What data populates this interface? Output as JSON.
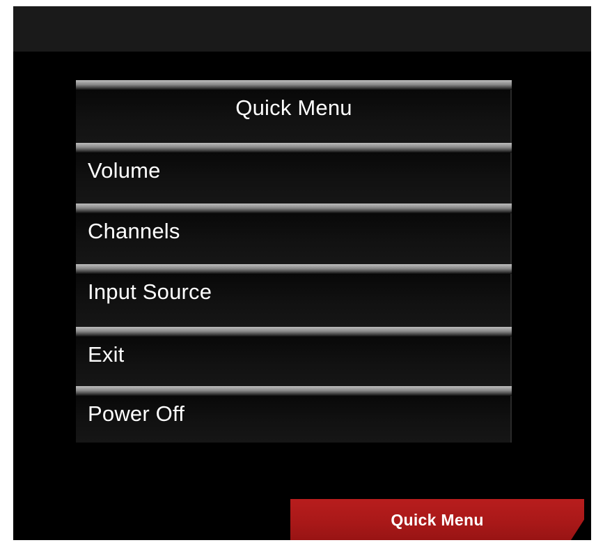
{
  "quick_menu": {
    "title": "Quick Menu",
    "items": [
      {
        "label": "Volume"
      },
      {
        "label": "Channels"
      },
      {
        "label": "Input Source"
      },
      {
        "label": "Exit"
      },
      {
        "label": "Power Off"
      }
    ]
  },
  "footer_tab": {
    "label": "Quick Menu"
  },
  "colors": {
    "background": "#000000",
    "top_bar": "#1a1a1a",
    "accent_tab": "#a81818",
    "text": "#ffffff"
  }
}
